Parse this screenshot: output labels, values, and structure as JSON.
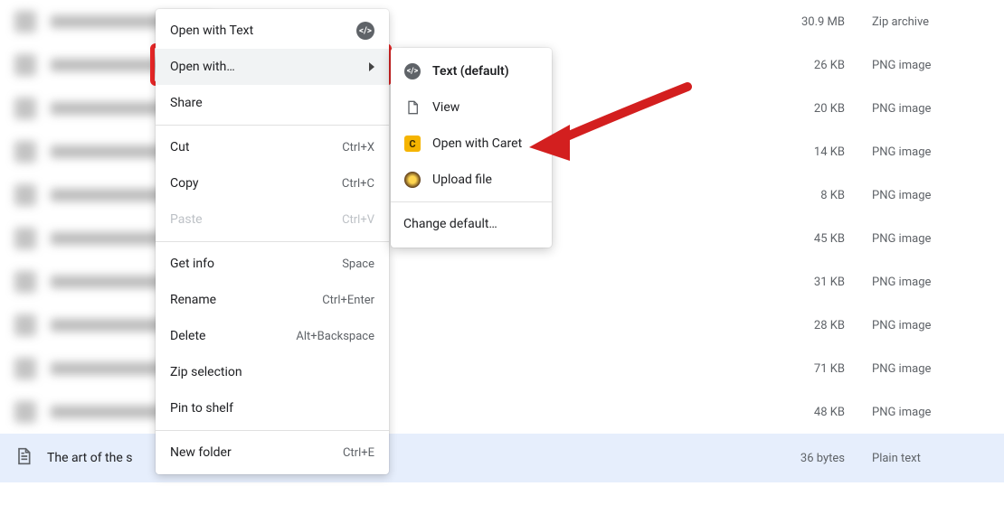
{
  "context_menu": {
    "items": [
      {
        "label": "Open with Text",
        "shortcut": "",
        "right_icon": "badge",
        "disabled": false,
        "hover": false
      },
      {
        "label": "Open with…",
        "shortcut": "",
        "right_icon": "submenu-arrow",
        "disabled": false,
        "hover": true,
        "highlighted_red": true
      },
      {
        "label": "Share",
        "shortcut": "",
        "disabled": false
      },
      {
        "sep": true
      },
      {
        "label": "Cut",
        "shortcut": "Ctrl+X",
        "disabled": false
      },
      {
        "label": "Copy",
        "shortcut": "Ctrl+C",
        "disabled": false
      },
      {
        "label": "Paste",
        "shortcut": "Ctrl+V",
        "disabled": true
      },
      {
        "sep": true
      },
      {
        "label": "Get info",
        "shortcut": "Space",
        "disabled": false
      },
      {
        "label": "Rename",
        "shortcut": "Ctrl+Enter",
        "disabled": false
      },
      {
        "label": "Delete",
        "shortcut": "Alt+Backspace",
        "disabled": false
      },
      {
        "label": "Zip selection",
        "shortcut": "",
        "disabled": false
      },
      {
        "label": "Pin to shelf",
        "shortcut": "",
        "disabled": false
      },
      {
        "sep": true
      },
      {
        "label": "New folder",
        "shortcut": "Ctrl+E",
        "disabled": false
      }
    ]
  },
  "submenu": {
    "items": [
      {
        "icon": "app-text",
        "label": "Text (default)",
        "bold": true
      },
      {
        "icon": "doc",
        "label": "View"
      },
      {
        "icon": "caret-app",
        "label": "Open with Caret",
        "hover": true
      },
      {
        "icon": "upload-app",
        "label": "Upload file"
      },
      {
        "sep": true
      },
      {
        "icon": "",
        "label": "Change default…"
      }
    ]
  },
  "file_list": {
    "rows": [
      {
        "size": "30.9 MB",
        "type": "Zip archive"
      },
      {
        "size": "26 KB",
        "type": "PNG image"
      },
      {
        "size": "20 KB",
        "type": "PNG image"
      },
      {
        "size": "14 KB",
        "type": "PNG image"
      },
      {
        "size": "8 KB",
        "type": "PNG image"
      },
      {
        "size": "45 KB",
        "type": "PNG image"
      },
      {
        "size": "31 KB",
        "type": "PNG image"
      },
      {
        "size": "28 KB",
        "type": "PNG image"
      },
      {
        "size": "71 KB",
        "type": "PNG image"
      },
      {
        "size": "48 KB",
        "type": "PNG image"
      }
    ],
    "selected_row": {
      "name_truncated": "The art of the s",
      "size": "36 bytes",
      "type": "Plain text"
    }
  }
}
